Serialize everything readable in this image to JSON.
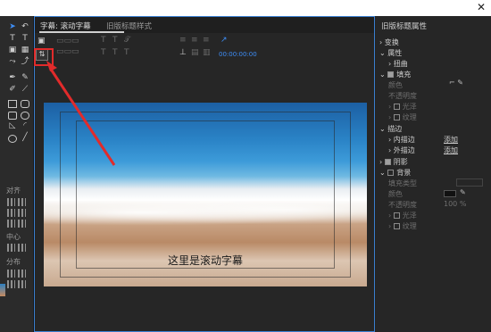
{
  "main": {
    "tab_active": "字幕: 滚动字幕",
    "tab_other": "旧版标题样式",
    "timecode": "00:00:00:00"
  },
  "caption": "这里是滚动字幕",
  "left": {
    "align_label": "对齐",
    "center_label": "中心",
    "distribute_label": "分布"
  },
  "right": {
    "title": "旧版标题属性",
    "rows": {
      "transform": "变换",
      "properties": "属性",
      "distort": "扭曲",
      "fill": "填充",
      "color": "颜色",
      "opacity": "不透明度",
      "sheen": "光泽",
      "texture": "纹理",
      "stroke": "描边",
      "inner_stroke": "内描边",
      "outer_stroke": "外描边",
      "add": "添加",
      "shadow": "阴影",
      "background": "背景",
      "fill_type": "填充类型",
      "bg_color": "颜色",
      "bg_opacity": "不透明度",
      "bg_opacity_value": "100 %",
      "bg_sheen": "光泽",
      "bg_texture": "纹理"
    }
  },
  "colors": {
    "accent": "#3e8ef7",
    "highlight": "#e12b2b"
  }
}
